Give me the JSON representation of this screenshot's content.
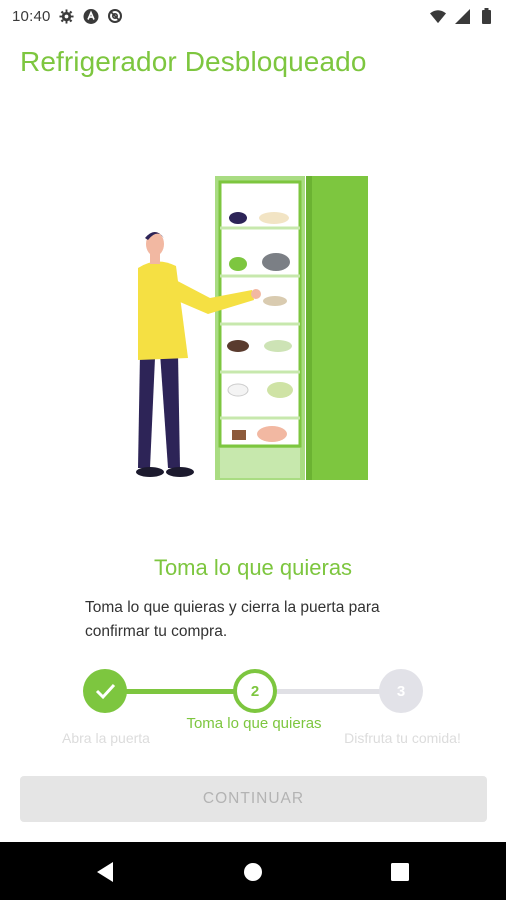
{
  "status_bar": {
    "time": "10:40",
    "left_icons": [
      "gear-icon",
      "android-icon",
      "data-saver-icon"
    ],
    "right_icons": [
      "wifi-icon",
      "signal-icon",
      "battery-icon"
    ]
  },
  "header": {
    "title": "Refrigerador Desbloqueado"
  },
  "illustration": {
    "subject": "person-taking-food-from-fridge"
  },
  "step_info": {
    "heading": "Toma lo que quieras",
    "description": "Toma lo que quieras y cierra la puerta para confirmar tu compra."
  },
  "stepper": {
    "current_step": 2,
    "steps": [
      {
        "number": "1",
        "label": "Abra la puerta",
        "status": "completed"
      },
      {
        "number": "2",
        "label": "Toma lo que quieras",
        "status": "current"
      },
      {
        "number": "3",
        "label": "Disfruta tu comida!",
        "status": "pending"
      }
    ]
  },
  "actions": {
    "continue_label": "CONTINUAR",
    "continue_enabled": false
  },
  "nav_bar": {
    "buttons": [
      "back-icon",
      "home-icon",
      "recents-icon"
    ]
  },
  "colors": {
    "accent": "#7dc63f",
    "pending": "#e2e2e8",
    "text": "#333333"
  }
}
